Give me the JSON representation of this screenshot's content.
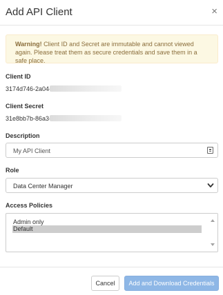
{
  "dialog": {
    "title": "Add API Client",
    "close_glyph": "×"
  },
  "warning": {
    "strong": "Warning!",
    "text": " Client ID and Secret are immutable and cannot viewed again. Please treat them as secure credentials and save them in a safe place."
  },
  "client_id": {
    "label": "Client ID",
    "value_visible": "3174d746-2a04-"
  },
  "client_secret": {
    "label": "Client Secret",
    "value_visible": "31e8bb7b-86a3-"
  },
  "description": {
    "label": "Description",
    "value": "My API Client"
  },
  "role": {
    "label": "Role",
    "selected": "Data Center Manager"
  },
  "access_policies": {
    "label": "Access Policies",
    "options": [
      {
        "label": "Admin only",
        "selected": false
      },
      {
        "label": "Default",
        "selected": true
      }
    ]
  },
  "footer": {
    "cancel_label": "Cancel",
    "primary_label": "Add and Download Credentials"
  },
  "colors": {
    "warning_bg": "#fcf8e3",
    "warning_text": "#8a6d3b",
    "primary_button": "#8eb7e6"
  },
  "icons": {
    "close": "close-icon",
    "description_field": "keyboard-icon",
    "role_select": "chevron-down-icon",
    "listbox_up": "scroll-up-icon",
    "listbox_down": "scroll-down-icon"
  }
}
